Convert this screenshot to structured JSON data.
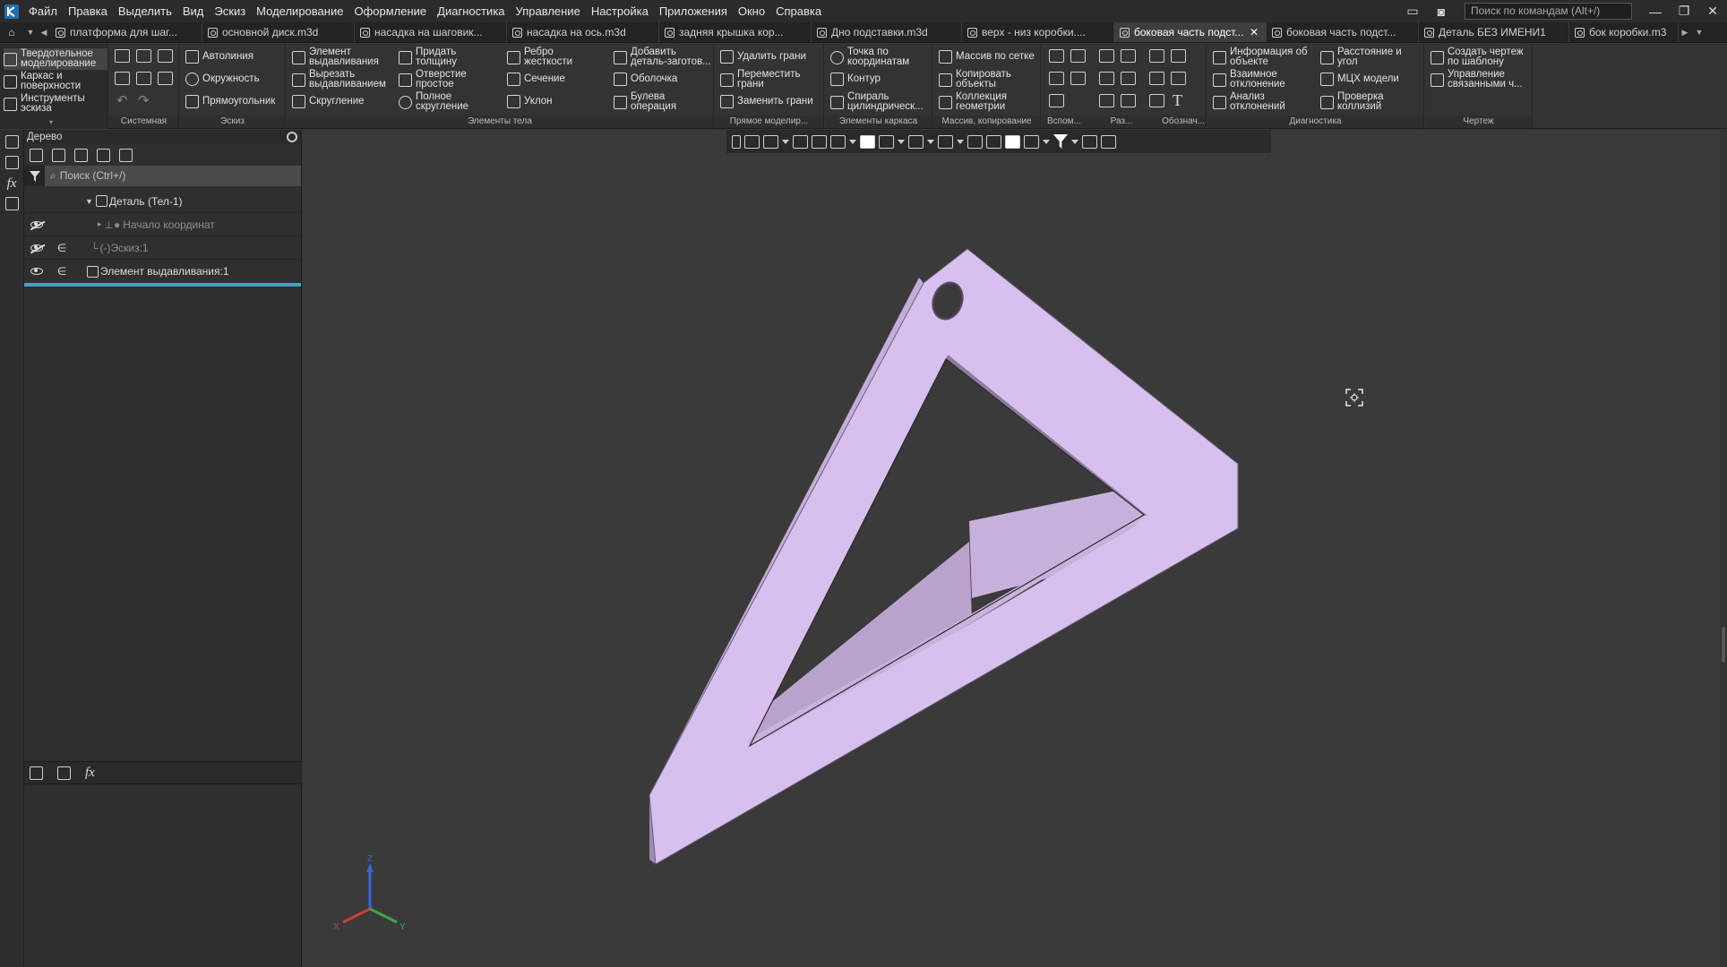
{
  "menubar": {
    "items": [
      "Файл",
      "Правка",
      "Выделить",
      "Вид",
      "Эскиз",
      "Моделирование",
      "Оформление",
      "Диагностика",
      "Управление",
      "Настройка",
      "Приложения",
      "Окно",
      "Справка"
    ],
    "command_search_placeholder": "Поиск по командам (Alt+/)"
  },
  "tabs": [
    {
      "label": "платформа для шаг..."
    },
    {
      "label": "основной диск.m3d"
    },
    {
      "label": "насадка на шаговик..."
    },
    {
      "label": "насадка на ось.m3d"
    },
    {
      "label": "задняя крышка кор..."
    },
    {
      "label": "Дно подставки.m3d"
    },
    {
      "label": "верх - низ коробки...."
    },
    {
      "label": "боковая часть подст...",
      "active": true
    },
    {
      "label": "боковая часть подст..."
    },
    {
      "label": "Деталь БЕЗ ИМЕНИ1"
    },
    {
      "label": "бок коробки.m3"
    }
  ],
  "ribbon": {
    "modes": [
      "Твердотельное моделирование",
      "Каркас и поверхности",
      "Инструменты эскиза"
    ],
    "groups": [
      "Системная",
      "Эскиз",
      "Элементы тела",
      "Прямое моделир...",
      "Элементы каркаса",
      "Массив, копирование",
      "Вспом...",
      "Раз...",
      "Обознач...",
      "Диагностика",
      "Чертеж"
    ],
    "sketch": [
      "Автолиния",
      "Окружность",
      "Прямоугольник"
    ],
    "body1": [
      "Элемент выдавливания",
      "Вырезать выдавливанием",
      "Скругление"
    ],
    "body2": [
      "Придать толщину",
      "Отверстие простое",
      "Полное скругление"
    ],
    "body3": [
      "Ребро жесткости",
      "Сечение",
      "Уклон"
    ],
    "body4": [
      "Добавить деталь-заготов...",
      "Оболочка",
      "Булева операция"
    ],
    "direct": [
      "Удалить грани",
      "Переместить грани",
      "Заменить грани"
    ],
    "wire": [
      "Точка по координатам",
      "Контур",
      "Спираль цилиндрическ..."
    ],
    "array": [
      "Массив по сетке",
      "Копировать объекты",
      "Коллекция геометрии"
    ],
    "diag1": [
      "Информация об объекте",
      "Взаимное отклонение",
      "Анализ отклонений"
    ],
    "diag2": [
      "Расстояние и угол",
      "МЦХ модели",
      "Проверка коллизий"
    ],
    "drawing": [
      "Создать чертеж по шаблону",
      "Управление связанными ч..."
    ]
  },
  "tree": {
    "title": "Дерево",
    "search_placeholder": "Поиск (Ctrl+/)",
    "nodes": [
      {
        "label": "Деталь (Тел-1)"
      },
      {
        "label": "Начало координат"
      },
      {
        "label": "(-)Эскиз:1"
      },
      {
        "label": "Элемент выдавливания:1"
      }
    ]
  },
  "viewport": {
    "part_color": "#d8c0ee",
    "axes": [
      "X",
      "Y",
      "Z"
    ]
  }
}
